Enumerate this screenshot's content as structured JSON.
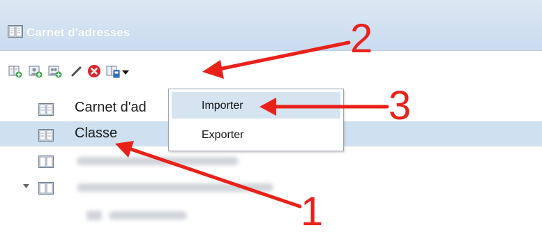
{
  "window": {
    "title": "Carnet d'adresses"
  },
  "toolbar": {
    "buttons": [
      {
        "icon": "new-address-book-icon"
      },
      {
        "icon": "new-contact-icon"
      },
      {
        "icon": "new-group-icon"
      },
      {
        "icon": "edit-pencil-icon"
      },
      {
        "icon": "delete-icon"
      },
      {
        "icon": "import-export-icon",
        "has_dropdown": true
      }
    ]
  },
  "tree": {
    "items": [
      {
        "label": "Carnet d'ad",
        "selected": false
      },
      {
        "label": "Classe",
        "selected": true
      }
    ]
  },
  "menu": {
    "items": [
      {
        "label": "Importer",
        "highlighted": true
      },
      {
        "label": "Exporter",
        "highlighted": false
      }
    ]
  },
  "annotations": {
    "labels": [
      "1",
      "2",
      "3"
    ],
    "color": "#e8221b"
  },
  "colors": {
    "header": "#cbdcef",
    "selection": "#cfe0f0",
    "menu_hover": "#d6e4f2"
  }
}
